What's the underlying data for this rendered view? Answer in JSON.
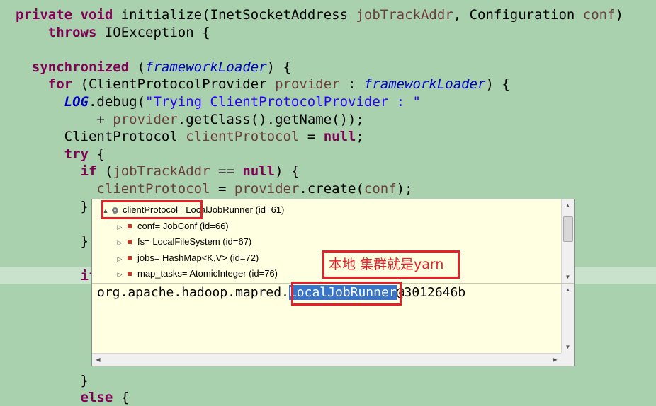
{
  "code": {
    "highlighted_line_index": 15,
    "lines": [
      [
        {
          "t": "private void",
          "c": "kw"
        },
        {
          "t": " initialize(InetSocketAddress ",
          "c": ""
        },
        {
          "t": "jobTrackAddr",
          "c": "var"
        },
        {
          "t": ", Configuration ",
          "c": ""
        },
        {
          "t": "conf",
          "c": "var"
        },
        {
          "t": ")",
          "c": ""
        }
      ],
      [
        {
          "t": "    throws",
          "c": "kw"
        },
        {
          "t": " IOException {",
          "c": ""
        }
      ],
      [],
      [
        {
          "t": "  synchronized",
          "c": "kw"
        },
        {
          "t": " (",
          "c": ""
        },
        {
          "t": "frameworkLoader",
          "c": "field"
        },
        {
          "t": ") {",
          "c": ""
        }
      ],
      [
        {
          "t": "    for",
          "c": "kw"
        },
        {
          "t": " (ClientProtocolProvider ",
          "c": ""
        },
        {
          "t": "provider",
          "c": "var"
        },
        {
          "t": " : ",
          "c": ""
        },
        {
          "t": "frameworkLoader",
          "c": "field"
        },
        {
          "t": ") {",
          "c": ""
        }
      ],
      [
        {
          "t": "      LOG",
          "c": "const"
        },
        {
          "t": ".debug(",
          "c": ""
        },
        {
          "t": "\"Trying ClientProtocolProvider : \"",
          "c": "str"
        }
      ],
      [
        {
          "t": "          + ",
          "c": ""
        },
        {
          "t": "provider",
          "c": "var"
        },
        {
          "t": ".getClass().getName());",
          "c": ""
        }
      ],
      [
        {
          "t": "      ClientProtocol ",
          "c": ""
        },
        {
          "t": "clientProtocol",
          "c": "var"
        },
        {
          "t": " = ",
          "c": ""
        },
        {
          "t": "null",
          "c": "kw"
        },
        {
          "t": ";",
          "c": ""
        }
      ],
      [
        {
          "t": "      try",
          "c": "kw"
        },
        {
          "t": " {",
          "c": ""
        }
      ],
      [
        {
          "t": "        if",
          "c": "kw"
        },
        {
          "t": " (",
          "c": ""
        },
        {
          "t": "jobTrackAddr",
          "c": "var"
        },
        {
          "t": " == ",
          "c": ""
        },
        {
          "t": "null",
          "c": "kw"
        },
        {
          "t": ") {",
          "c": ""
        }
      ],
      [
        {
          "t": "          ",
          "c": ""
        },
        {
          "t": "clientProtocol",
          "c": "var"
        },
        {
          "t": " = ",
          "c": ""
        },
        {
          "t": "provider",
          "c": "var"
        },
        {
          "t": ".create(",
          "c": ""
        },
        {
          "t": "conf",
          "c": "var"
        },
        {
          "t": ");",
          "c": ""
        }
      ],
      [
        {
          "t": "        }",
          "c": ""
        }
      ],
      [],
      [
        {
          "t": "        }",
          "c": ""
        }
      ],
      [],
      [
        {
          "t": "        if",
          "c": "kw"
        }
      ],
      [],
      [],
      [],
      [],
      [],
      [
        {
          "t": "        }",
          "c": ""
        }
      ],
      [
        {
          "t": "        else",
          "c": "kw"
        },
        {
          "t": " {",
          "c": ""
        }
      ]
    ]
  },
  "inspector": {
    "tree": [
      {
        "toggle": "▲",
        "icon": "local",
        "label": "clientProtocol= LocalJobRunner  (id=61)",
        "level": 0
      },
      {
        "toggle": "▷",
        "icon": "field",
        "label": "conf= JobConf  (id=66)",
        "level": 1
      },
      {
        "toggle": "▷",
        "icon": "field",
        "label": "fs= LocalFileSystem  (id=67)",
        "level": 1
      },
      {
        "toggle": "▷",
        "icon": "field",
        "label": "jobs= HashMap<K,V>  (id=72)",
        "level": 1
      },
      {
        "toggle": "▷",
        "icon": "field",
        "label": "map_tasks= AtomicInteger  (id=76)",
        "level": 1
      }
    ],
    "detail": {
      "prefix": "org.apache.hadoop.mapred.",
      "selected": "LocalJobRunner",
      "suffix": "@3012646b"
    }
  },
  "annotation": {
    "text": "本地 集群就是yarn",
    "color": "#e5202a"
  }
}
